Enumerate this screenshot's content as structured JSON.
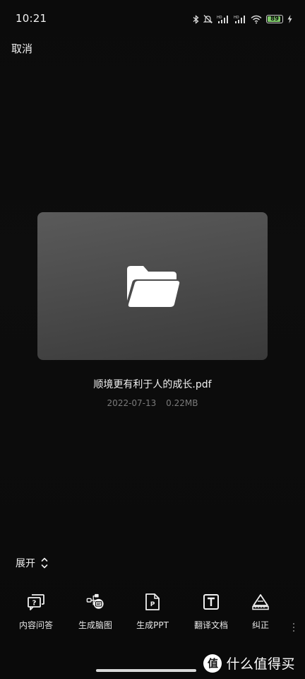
{
  "status_bar": {
    "time": "10:21",
    "battery_level": "89",
    "icons": [
      "bluetooth-icon",
      "mute-icon",
      "signal-hd-icon",
      "signal-hd-icon",
      "wifi-icon",
      "battery-icon",
      "charging-icon"
    ]
  },
  "header": {
    "cancel_label": "取消"
  },
  "file": {
    "icon": "folder-icon",
    "name": "顺境更有利于人的成长.pdf",
    "date": "2022-07-13",
    "size": "0.22MB"
  },
  "expand": {
    "label": "展开",
    "icon": "chevron-up-down-icon"
  },
  "toolbar": {
    "items": [
      {
        "label": "内容问答",
        "icon": "qa-chat-icon"
      },
      {
        "label": "生成脑图",
        "icon": "mind-map-icon"
      },
      {
        "label": "生成PPT",
        "icon": "ppt-icon"
      },
      {
        "label": "翻译文档",
        "icon": "translate-t-icon"
      },
      {
        "label": "纠正",
        "icon": "ruler-icon"
      }
    ]
  },
  "watermark": {
    "badge": "值",
    "text": "什么值得买"
  },
  "colors": {
    "background": "#0b0b0b",
    "card": "#4c4c4c",
    "battery_fill": "#7ec96a",
    "meta_text": "#7a7a7a"
  }
}
